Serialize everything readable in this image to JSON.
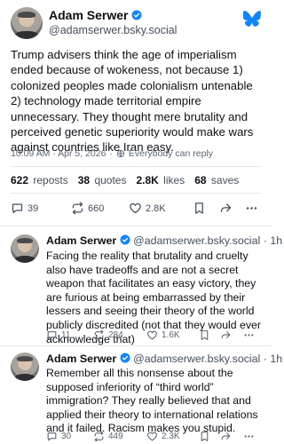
{
  "main": {
    "author": {
      "name": "Adam Serwer",
      "handle": "@adamserwer.bsky.social"
    },
    "text": "Trump advisers think the age of imperialism ended because of wokeness, not because 1) colonized peoples made colonialism untenable 2) technology made territorial empire unnecessary. They thought mere brutality and perceived genetic superiority would make wars against countries like Iran easy.",
    "timestamp": "10:09 AM · Apr 5, 2026",
    "reply_setting": "Everybody can reply",
    "stats": {
      "reposts_count": "622",
      "reposts_label": "reposts",
      "quotes_count": "38",
      "quotes_label": "quotes",
      "likes_count": "2.8K",
      "likes_label": "likes",
      "saves_count": "68",
      "saves_label": "saves"
    },
    "actions": {
      "replies": "39",
      "reposts": "660",
      "likes": "2.8K"
    }
  },
  "replies": [
    {
      "name": "Adam Serwer",
      "handle": "@adamserwer.bsky.social",
      "time": "· 1h",
      "text": "Facing the reality that brutality and cruelty also have tradeoffs and are not a secret weapon that facilitates an easy victory, they are furious at being embarrassed by their lessers and seeing their theory of the world publicly discredited (not that they would ever acknowledge that)",
      "replies": "11",
      "reposts": "284",
      "likes": "1.6K"
    },
    {
      "name": "Adam Serwer",
      "handle": "@adamserwer.bsky.social",
      "time": "· 1h",
      "text": "Remember all this nonsense about the supposed inferiority of “third world” immigration? They really believed that and applied their theory to international relations and it failed. Racism makes you stupid.",
      "replies": "30",
      "reposts": "449",
      "likes": "2.3K"
    }
  ],
  "colors": {
    "accent": "#1185fe",
    "text": "#0b0f14",
    "muted": "#5b6775"
  }
}
